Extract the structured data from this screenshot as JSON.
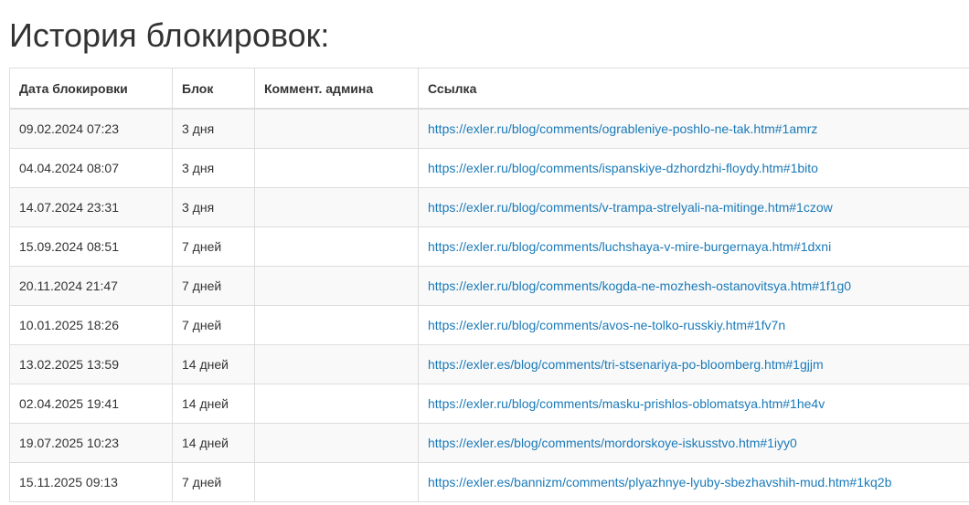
{
  "page": {
    "title": "История блокировок:"
  },
  "table": {
    "headers": {
      "date": "Дата блокировки",
      "block": "Блок",
      "comment": "Коммент. админа",
      "link": "Ссылка"
    },
    "rows": [
      {
        "date": "09.02.2024 07:23",
        "block": "3 дня",
        "comment": "",
        "link": "https://exler.ru/blog/comments/ogrableniye-poshlo-ne-tak.htm#1amrz"
      },
      {
        "date": "04.04.2024 08:07",
        "block": "3 дня",
        "comment": "",
        "link": "https://exler.ru/blog/comments/ispanskiye-dzhordzhi-floydy.htm#1bito"
      },
      {
        "date": "14.07.2024 23:31",
        "block": "3 дня",
        "comment": "",
        "link": "https://exler.ru/blog/comments/v-trampa-strelyali-na-mitinge.htm#1czow"
      },
      {
        "date": "15.09.2024 08:51",
        "block": "7 дней",
        "comment": "",
        "link": "https://exler.ru/blog/comments/luchshaya-v-mire-burgernaya.htm#1dxni"
      },
      {
        "date": "20.11.2024 21:47",
        "block": "7 дней",
        "comment": "",
        "link": "https://exler.ru/blog/comments/kogda-ne-mozhesh-ostanovitsya.htm#1f1g0"
      },
      {
        "date": "10.01.2025 18:26",
        "block": "7 дней",
        "comment": "",
        "link": "https://exler.ru/blog/comments/avos-ne-tolko-russkiy.htm#1fv7n"
      },
      {
        "date": "13.02.2025 13:59",
        "block": "14 дней",
        "comment": "",
        "link": "https://exler.es/blog/comments/tri-stsenariya-po-bloomberg.htm#1gjjm"
      },
      {
        "date": "02.04.2025 19:41",
        "block": "14 дней",
        "comment": "",
        "link": "https://exler.ru/blog/comments/masku-prishlos-oblomatsya.htm#1he4v"
      },
      {
        "date": "19.07.2025 10:23",
        "block": "14 дней",
        "comment": "",
        "link": "https://exler.es/blog/comments/mordorskoye-iskusstvo.htm#1iyy0"
      },
      {
        "date": "15.11.2025 09:13",
        "block": "7 дней",
        "comment": "",
        "link": "https://exler.es/bannizm/comments/plyazhnye-lyuby-sbezhavshih-mud.htm#1kq2b"
      }
    ]
  },
  "colors": {
    "text": "#333333",
    "link": "#1a7ab8",
    "border": "#dddddd",
    "stripe": "#f9f9f9"
  }
}
